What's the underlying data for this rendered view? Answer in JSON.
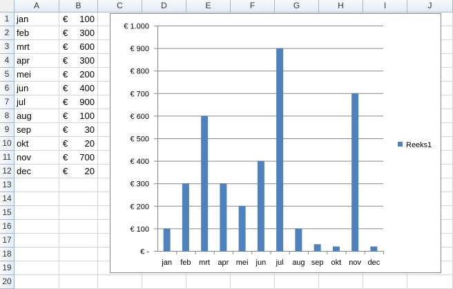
{
  "columns": [
    "A",
    "B",
    "C",
    "D",
    "E",
    "F",
    "G",
    "H",
    "I",
    "J"
  ],
  "rows": [
    "1",
    "2",
    "3",
    "4",
    "5",
    "6",
    "7",
    "8",
    "9",
    "10",
    "11",
    "12",
    "13",
    "14",
    "15",
    "16",
    "17",
    "18",
    "19",
    "20"
  ],
  "table": [
    {
      "month": "jan",
      "currency": "€",
      "value": "100"
    },
    {
      "month": "feb",
      "currency": "€",
      "value": "300"
    },
    {
      "month": "mrt",
      "currency": "€",
      "value": "600"
    },
    {
      "month": "apr",
      "currency": "€",
      "value": "300"
    },
    {
      "month": "mei",
      "currency": "€",
      "value": "200"
    },
    {
      "month": "jun",
      "currency": "€",
      "value": "400"
    },
    {
      "month": "jul",
      "currency": "€",
      "value": "900"
    },
    {
      "month": "aug",
      "currency": "€",
      "value": "100"
    },
    {
      "month": "sep",
      "currency": "€",
      "value": "30"
    },
    {
      "month": "okt",
      "currency": "€",
      "value": "20"
    },
    {
      "month": "nov",
      "currency": "€",
      "value": "700"
    },
    {
      "month": "dec",
      "currency": "€",
      "value": "20"
    }
  ],
  "chart_data": {
    "type": "bar",
    "categories": [
      "jan",
      "feb",
      "mrt",
      "apr",
      "mei",
      "jun",
      "jul",
      "aug",
      "sep",
      "okt",
      "nov",
      "dec"
    ],
    "series": [
      {
        "name": "Reeks1",
        "values": [
          100,
          300,
          600,
          300,
          200,
          400,
          900,
          100,
          30,
          20,
          700,
          20
        ],
        "color": "#4f81bd"
      }
    ],
    "ylim": [
      0,
      1000
    ],
    "yticks": [
      0,
      100,
      200,
      300,
      400,
      500,
      600,
      700,
      800,
      900,
      1000
    ],
    "ytick_labels": [
      "€ -",
      "€ 100",
      "€ 200",
      "€ 300",
      "€ 400",
      "€ 500",
      "€ 600",
      "€ 700",
      "€ 800",
      "€ 900",
      "€ 1.000"
    ],
    "grid": true,
    "legend_position": "right"
  }
}
